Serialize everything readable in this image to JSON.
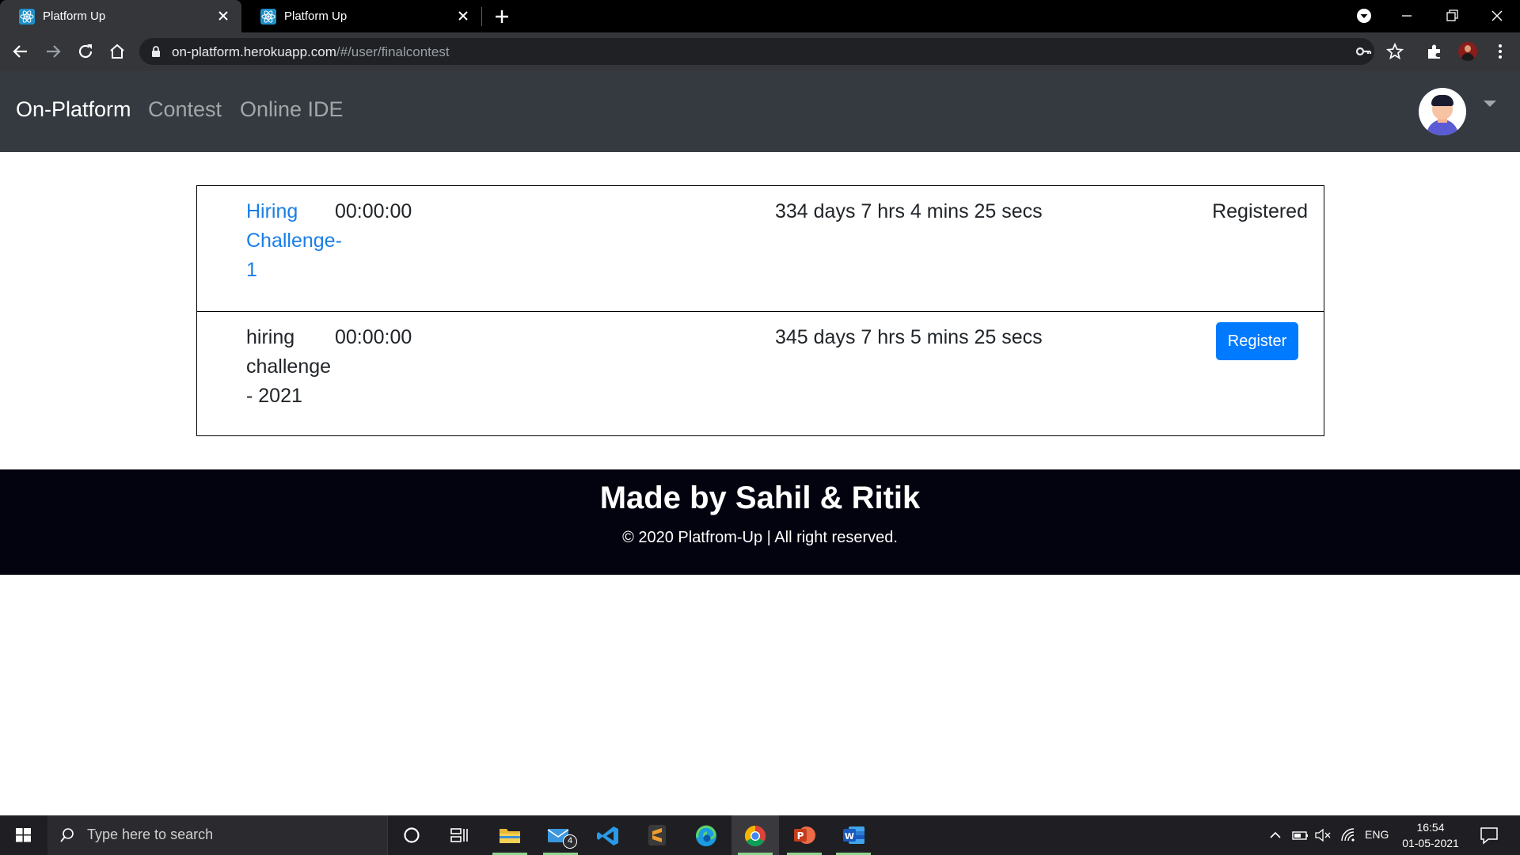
{
  "browser": {
    "tabs": [
      {
        "title": "Platform Up",
        "active": true
      },
      {
        "title": "Platform Up",
        "active": false
      }
    ],
    "url_host": "on-platform.herokuapp.com",
    "url_path": "/#/user/finalcontest"
  },
  "navbar": {
    "brand": "On-Platform",
    "links": [
      "Contest",
      "Online IDE"
    ]
  },
  "contests": [
    {
      "name": "Hiring Challenge-1",
      "is_link": true,
      "time": "00:00:00",
      "time_left": "334 days 7 hrs 4 mins 25 secs",
      "status": "Registered"
    },
    {
      "name": "hiring challenge - 2021",
      "is_link": false,
      "time": "00:00:00",
      "time_left": "345 days 7 hrs 5 mins 25 secs",
      "action": "Register"
    }
  ],
  "footer": {
    "title": "Made by Sahil & Ritik",
    "copyright": "© 2020 Platfrom-Up | All right reserved."
  },
  "taskbar": {
    "search_placeholder": "Type here to search",
    "mail_badge": "4",
    "language": "ENG",
    "time": "16:54",
    "date": "01-05-2021"
  },
  "colors": {
    "accent": "#007bff",
    "link": "#1a7ee6",
    "navbar_bg": "#343a40",
    "footer_bg": "#03020f"
  },
  "icons": [
    "react-favicon-icon",
    "close-icon",
    "plus-icon",
    "back-arrow-icon",
    "forward-arrow-icon",
    "reload-icon",
    "home-icon",
    "lock-icon",
    "key-icon",
    "star-icon",
    "extensions-icon",
    "profile-icon",
    "menu-dots-icon",
    "avatar-icon",
    "caret-down-icon",
    "windows-start-icon",
    "search-icon",
    "cortana-icon",
    "task-view-icon",
    "file-explorer-icon",
    "mail-icon",
    "vscode-icon",
    "sublime-icon",
    "edge-icon",
    "chrome-icon",
    "powerpoint-icon",
    "word-icon"
  ]
}
